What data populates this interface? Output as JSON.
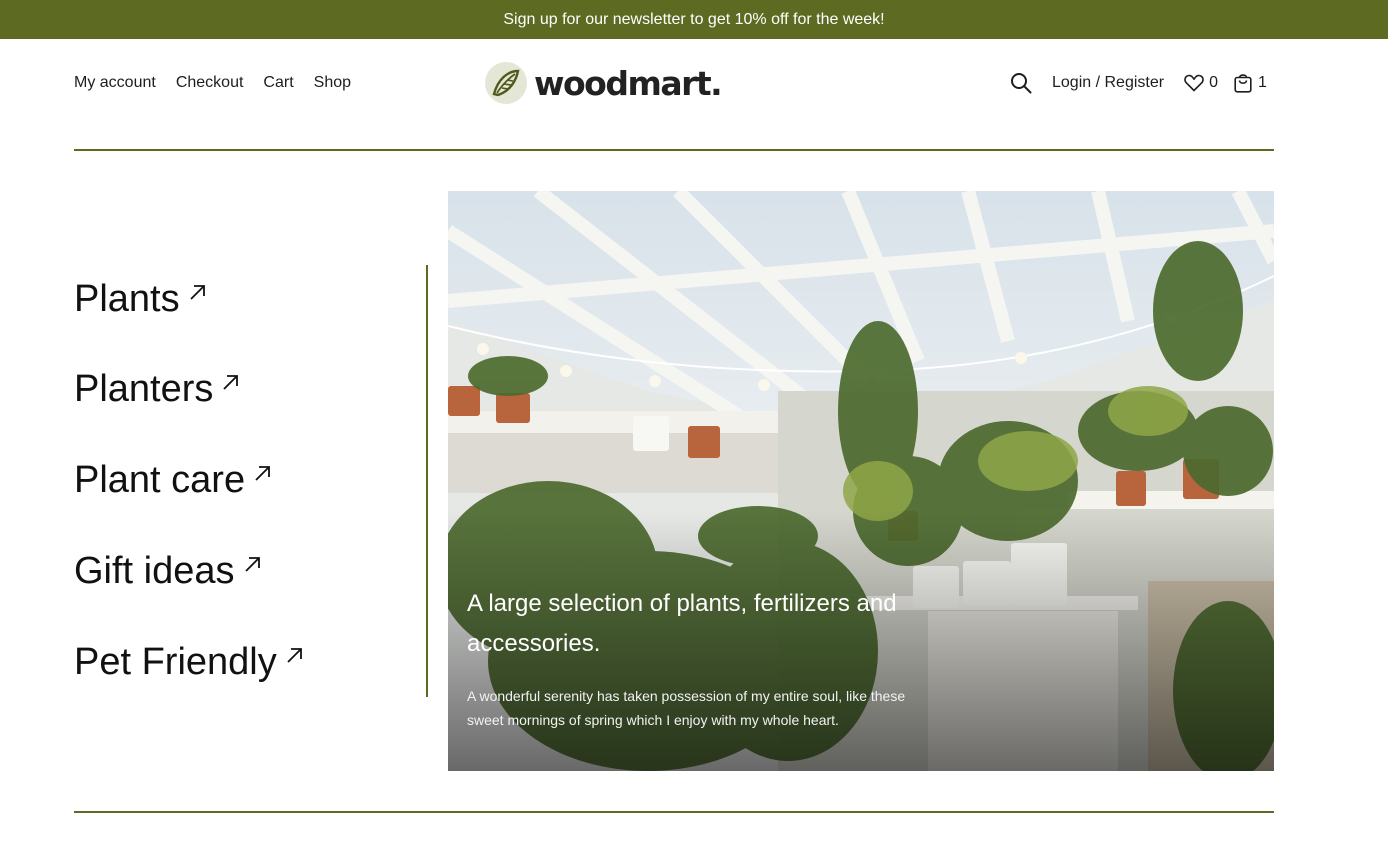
{
  "topbar": {
    "text": "Sign up for our newsletter to get 10% off for the week!"
  },
  "nav_left": [
    "My account",
    "Checkout",
    "Cart",
    "Shop"
  ],
  "logo": {
    "text": "woodmart."
  },
  "nav_right": {
    "search_icon": "search-icon",
    "login_label": "Login / Register",
    "wishlist_icon": "heart-icon",
    "wishlist_count": "0",
    "cart_icon": "shopping-bag-icon",
    "cart_count": "1"
  },
  "categories": [
    "Plants",
    "Planters",
    "Plant care",
    "Gift ideas",
    "Pet Friendly"
  ],
  "hero": {
    "title": "A large selection of plants, fertilizers and accessories.",
    "text": "A wonderful serenity has taken possession of my entire soul, like these sweet mornings of spring which I enjoy with my whole heart."
  },
  "colors": {
    "accent": "#5d6a22",
    "text": "#1e1e1e",
    "background": "#ffffff"
  }
}
